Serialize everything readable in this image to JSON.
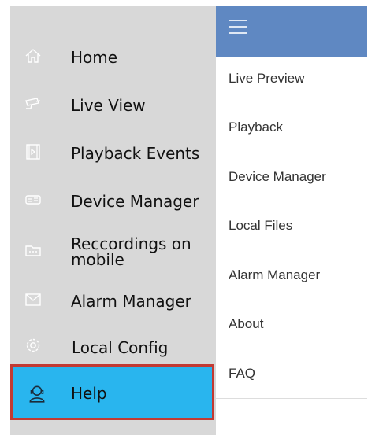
{
  "drawer": {
    "items": [
      {
        "icon": "home-icon",
        "label": "Home"
      },
      {
        "icon": "camera-icon",
        "label": "Live View"
      },
      {
        "icon": "film-icon",
        "label": "Playback Events"
      },
      {
        "icon": "dvr-device-icon",
        "label": "Device Manager"
      },
      {
        "icon": "folder-icon",
        "label": "Reccordings on mobile"
      },
      {
        "icon": "alarm-envelope-icon",
        "label": "Alarm Manager"
      },
      {
        "icon": "gear-icon",
        "label": "Local Config"
      },
      {
        "icon": "support-agent-icon",
        "label": "Help"
      }
    ],
    "selected_index": 7
  },
  "menu": {
    "header_icon": "hamburger-icon",
    "items": [
      {
        "label": "Live Preview"
      },
      {
        "label": "Playback"
      },
      {
        "label": "Device Manager"
      },
      {
        "label": "Local Files"
      },
      {
        "label": "Alarm Manager"
      },
      {
        "label": "About"
      },
      {
        "label": "FAQ"
      }
    ]
  },
  "colors": {
    "drawer_bg": "#d8d8d8",
    "selected_bg": "#29b5ee",
    "highlight_border": "#c23a33",
    "menu_header_bg": "#5f88c2"
  }
}
